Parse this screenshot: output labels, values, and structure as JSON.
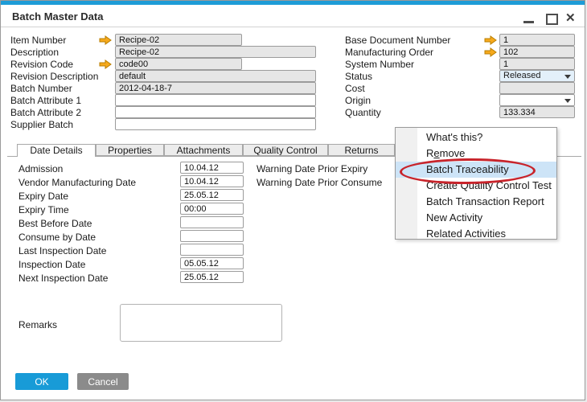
{
  "window": {
    "title": "Batch Master Data",
    "icons": {
      "minimize": "minimize-bar",
      "maximize": "maximize-square",
      "close_glyph": "✕",
      "link_arrow": "orange-right-arrow",
      "dropdown_arrow": "down-triangle"
    }
  },
  "form_left": [
    {
      "label": "Item Number",
      "value": "Recipe-02"
    },
    {
      "label": "Description",
      "value": "Recipe-02"
    },
    {
      "label": "Revision Code",
      "value": "code00"
    },
    {
      "label": "Revision Description",
      "value": "default"
    },
    {
      "label": "Batch Number",
      "value": "2012-04-18-7"
    },
    {
      "label": "Batch Attribute 1",
      "value": ""
    },
    {
      "label": "Batch Attribute 2",
      "value": ""
    },
    {
      "label": "Supplier Batch",
      "value": ""
    }
  ],
  "form_right": [
    {
      "label": "Base Document Number",
      "value": "1"
    },
    {
      "label": "Manufacturing Order",
      "value": "102"
    },
    {
      "label": "System Number",
      "value": "1"
    },
    {
      "label": "Status",
      "value": "Released"
    },
    {
      "label": "Cost",
      "value": ""
    },
    {
      "label": "Origin",
      "value": ""
    },
    {
      "label": "Quantity",
      "value": "133.334"
    }
  ],
  "tabs": [
    {
      "label": "Date Details"
    },
    {
      "label": "Properties"
    },
    {
      "label": "Attachments"
    },
    {
      "label": "Quality Control"
    },
    {
      "label": "Returns"
    }
  ],
  "date_details": {
    "rows": [
      {
        "label": "Admission",
        "value": "10.04.12"
      },
      {
        "label": "Vendor Manufacturing Date",
        "value": "10.04.12"
      },
      {
        "label": "Expiry Date",
        "value": "25.05.12"
      },
      {
        "label": "Expiry Time",
        "value": "00:00"
      },
      {
        "label": "Best Before Date",
        "value": ""
      },
      {
        "label": "Consume by Date",
        "value": ""
      },
      {
        "label": "Last Inspection Date",
        "value": ""
      },
      {
        "label": "Inspection Date",
        "value": "05.05.12"
      },
      {
        "label": "Next Inspection Date",
        "value": "25.05.12"
      }
    ],
    "warnings": [
      {
        "label": "Warning Date Prior Expiry"
      },
      {
        "label": "Warning Date Prior Consume"
      }
    ]
  },
  "remarks": {
    "label": "Remarks",
    "value": ""
  },
  "buttons": {
    "ok": "OK",
    "cancel": "Cancel"
  },
  "context_menu": {
    "items": [
      {
        "label": "What's this?"
      },
      {
        "pre": "R",
        "u": "e",
        "post": "move"
      },
      {
        "label": "Batch Traceability",
        "highlighted": true
      },
      {
        "label": "Create Quality Control Test"
      },
      {
        "label": "Batch Transaction Report"
      },
      {
        "label": "New Activity"
      },
      {
        "label": "Related Activities"
      }
    ]
  },
  "colors": {
    "accent_blue": "#1e9cd7",
    "ok_button": "#189bd7",
    "cancel_button": "#8b8b8b",
    "menu_highlight": "#cde4f7",
    "annotation_red": "#c8242b",
    "disabled_field": "#e6e6e6",
    "status_field": "#e3f0fa"
  }
}
